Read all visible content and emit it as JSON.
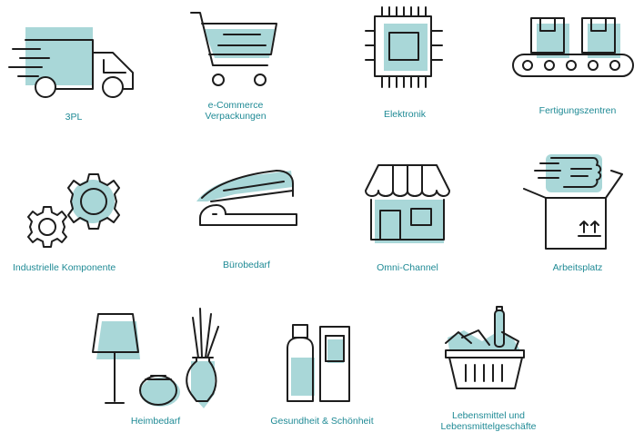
{
  "colors": {
    "accent_fill": "#a9d7d8",
    "label_text": "#1f8a95",
    "stroke": "#1d1d1d"
  },
  "categories": [
    {
      "label": "3PL",
      "icon": "delivery-truck-icon"
    },
    {
      "label": "e-Commerce\nVerpackungen",
      "icon": "shopping-cart-icon"
    },
    {
      "label": "Elektronik",
      "icon": "microchip-icon"
    },
    {
      "label": "Fertigungszentren",
      "icon": "conveyor-belt-icon"
    },
    {
      "label": "Industrielle Komponente",
      "icon": "gears-icon"
    },
    {
      "label": "Bürobedarf",
      "icon": "stapler-icon"
    },
    {
      "label": "Omni-Channel",
      "icon": "storefront-icon"
    },
    {
      "label": "Arbeitsplatz",
      "icon": "open-box-icon"
    },
    {
      "label": "Heimbedarf",
      "icon": "home-decor-icon"
    },
    {
      "label": "Gesundheit & Schönheit",
      "icon": "cosmetics-bottles-icon"
    },
    {
      "label": "Lebensmittel und\nLebensmittelgeschäfte",
      "icon": "grocery-basket-icon"
    }
  ]
}
